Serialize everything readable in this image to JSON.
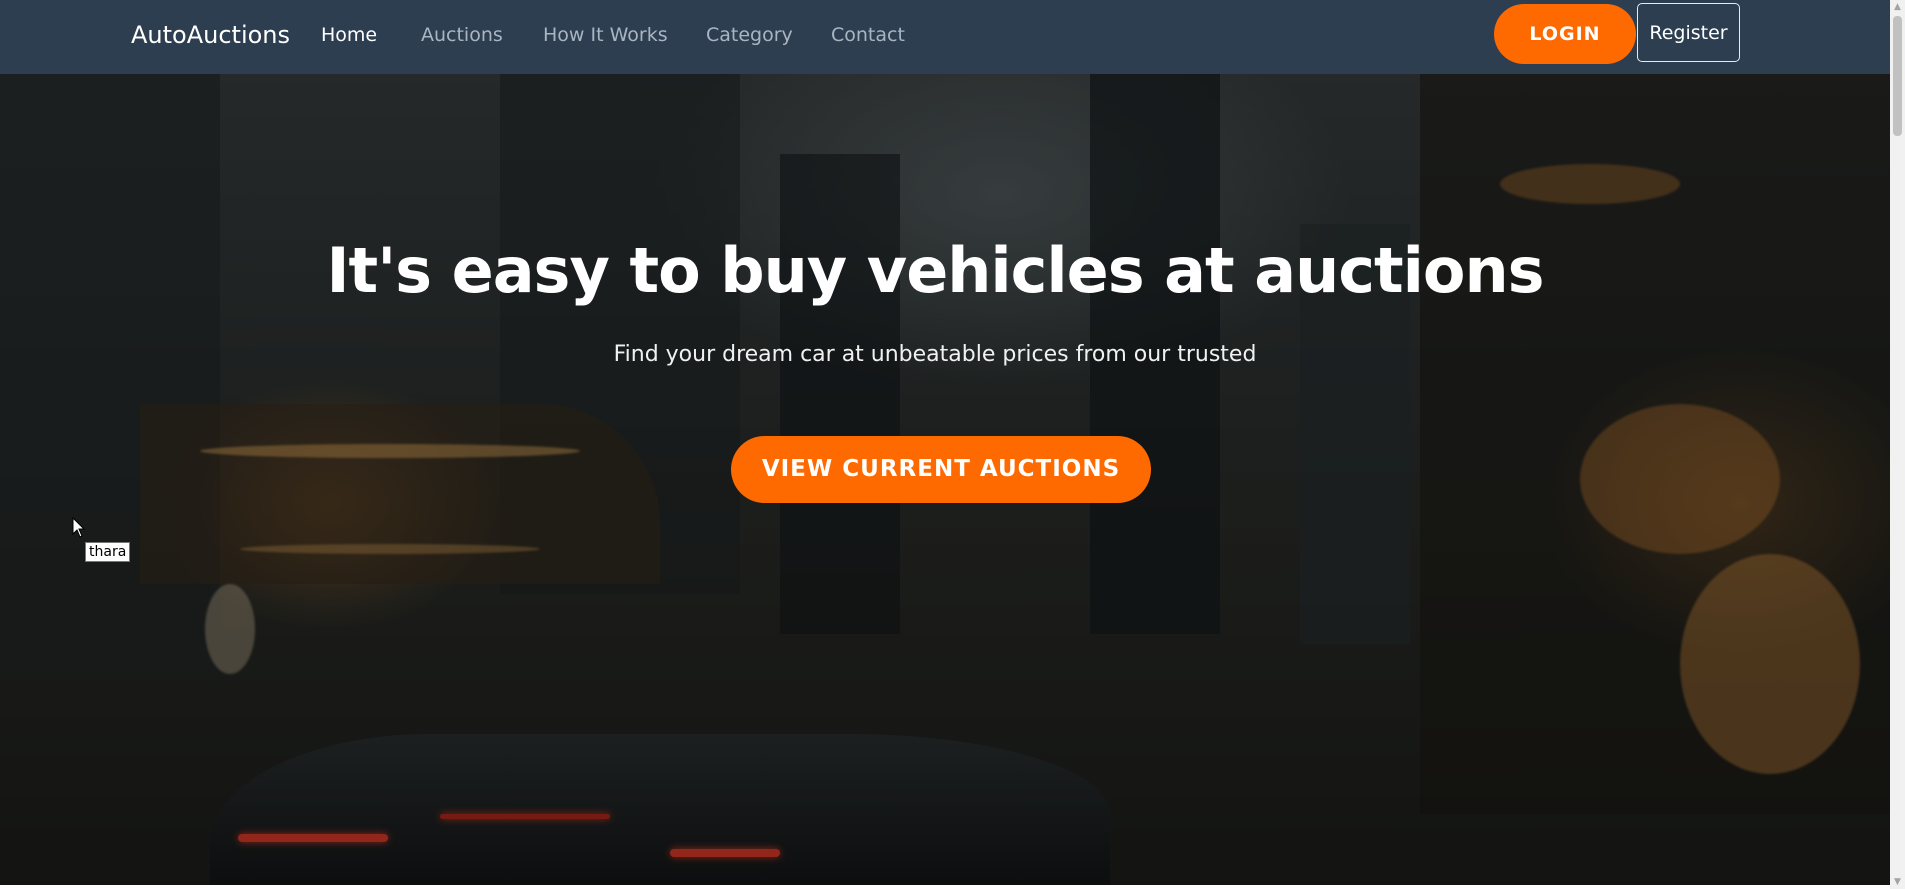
{
  "navbar": {
    "brand": "AutoAuctions",
    "links": [
      {
        "label": "Home",
        "active": true
      },
      {
        "label": "Auctions",
        "active": false
      },
      {
        "label": "How It Works",
        "active": false
      },
      {
        "label": "Category",
        "active": false
      },
      {
        "label": "Contact",
        "active": false
      }
    ],
    "login_label": "LOGIN",
    "register_label": "Register"
  },
  "hero": {
    "title": "It's easy to buy vehicles at auctions",
    "subtitle": "Find your dream car at unbeatable prices from our trusted",
    "cta_label": "VIEW CURRENT AUCTIONS"
  },
  "tooltip": {
    "text": "thara"
  },
  "colors": {
    "navbar_bg": "#2c3e50",
    "accent": "#ff6a00",
    "nav_inactive": "#a9b5c2",
    "nav_active": "#ffffff"
  },
  "icons": {
    "cursor": "mouse-pointer-icon",
    "scroll_up": "chevron-up-icon",
    "scroll_down": "chevron-down-icon"
  }
}
